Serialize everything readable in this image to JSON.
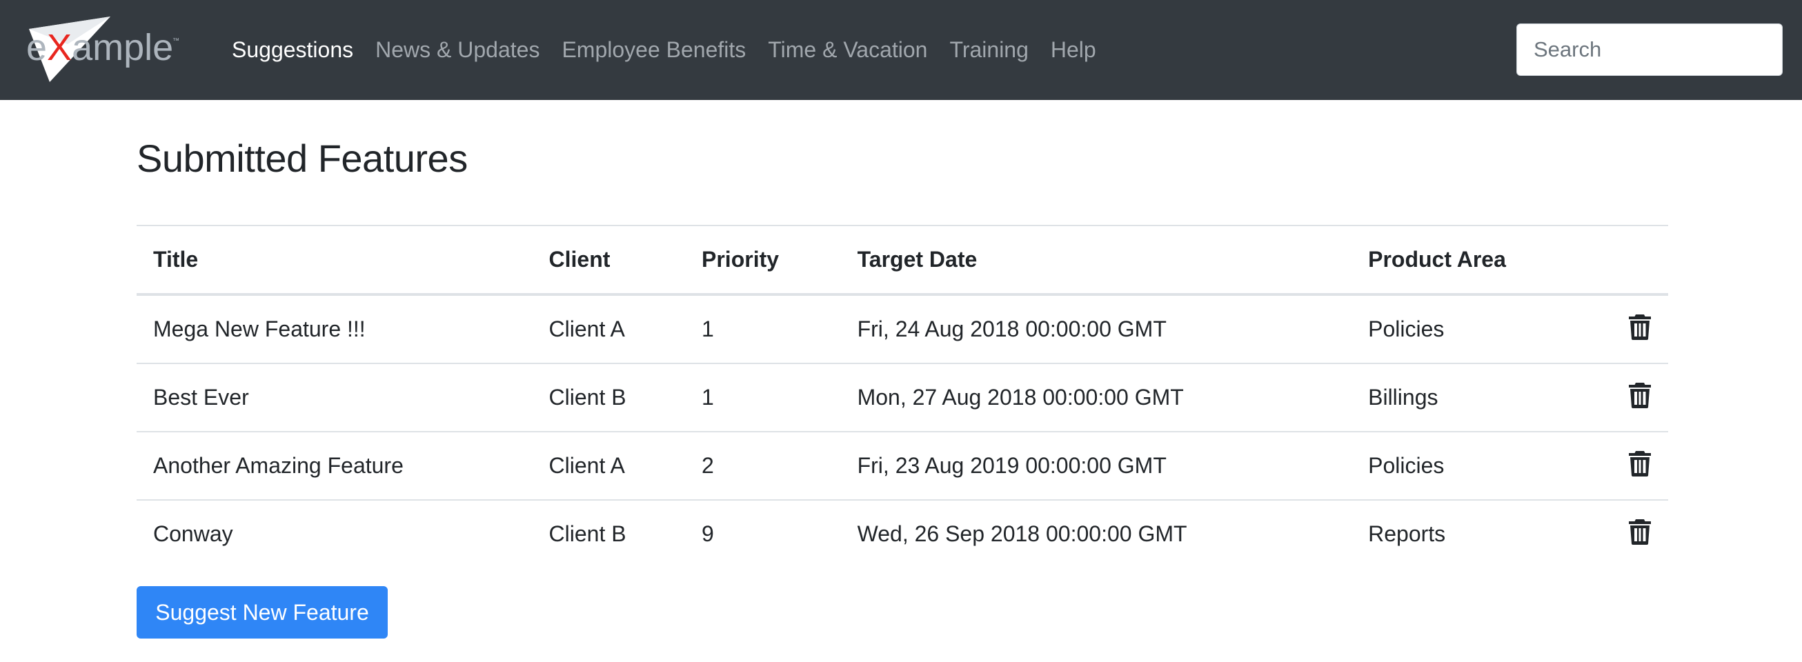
{
  "brand": {
    "logo_text_pre": "e",
    "logo_text_x": "X",
    "logo_text_post": "ample",
    "trademark": "™"
  },
  "nav": {
    "items": [
      {
        "label": "Suggestions",
        "active": true
      },
      {
        "label": "News & Updates"
      },
      {
        "label": "Employee Benefits"
      },
      {
        "label": "Time & Vacation"
      },
      {
        "label": "Training"
      },
      {
        "label": "Help"
      }
    ]
  },
  "search": {
    "placeholder": "Search"
  },
  "page": {
    "title": "Submitted Features"
  },
  "table": {
    "headers": [
      "Title",
      "Client",
      "Priority",
      "Target Date",
      "Product Area",
      ""
    ],
    "rows": [
      {
        "title": "Mega New Feature !!!",
        "client": "Client A",
        "priority": "1",
        "target_date": "Fri, 24 Aug 2018 00:00:00 GMT",
        "product_area": "Policies",
        "action_icon": "trash-icon"
      },
      {
        "title": "Best Ever",
        "client": "Client B",
        "priority": "1",
        "target_date": "Mon, 27 Aug 2018 00:00:00 GMT",
        "product_area": "Billings",
        "action_icon": "trash-icon"
      },
      {
        "title": "Another Amazing Feature",
        "client": "Client A",
        "priority": "2",
        "target_date": "Fri, 23 Aug 2019 00:00:00 GMT",
        "product_area": "Policies",
        "action_icon": "trash-icon"
      },
      {
        "title": "Conway",
        "client": "Client B",
        "priority": "9",
        "target_date": "Wed, 26 Sep 2018 00:00:00 GMT",
        "product_area": "Reports",
        "action_icon": "trash-icon"
      }
    ]
  },
  "actions": {
    "suggest_label": "Suggest New Feature"
  },
  "colors": {
    "navbar": "#343a40",
    "primary": "#2f86f6",
    "logo_accent": "#e8261f"
  }
}
